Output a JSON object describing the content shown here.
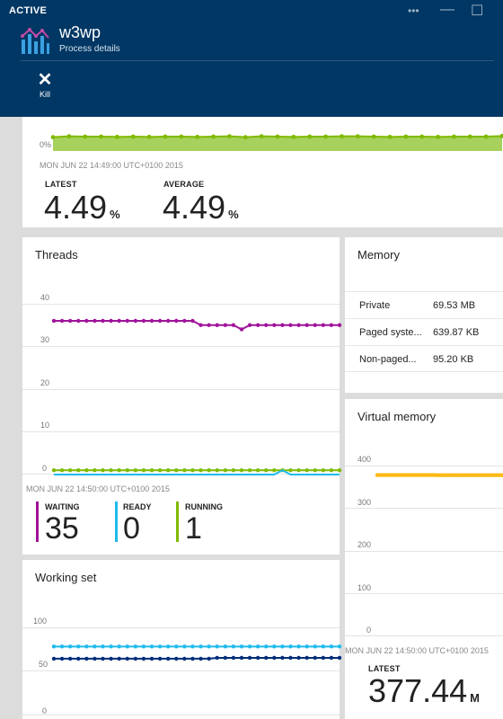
{
  "header": {
    "status": "ACTIVE",
    "ellipsis": "•••",
    "minimize": "—",
    "maximize": "☐",
    "app_name": "w3wp",
    "subtitle": "Process details",
    "kill_label": "Kill"
  },
  "cpu": {
    "axis_zero": "0%",
    "time_label": "MON JUN 22 14:49:00 UTC+0100 2015",
    "latest_label": "LATEST",
    "latest_value": "4.49",
    "average_label": "AVERAGE",
    "average_value": "4.49",
    "unit": "%"
  },
  "threads": {
    "title": "Threads",
    "y_ticks": [
      "40",
      "30",
      "20",
      "10",
      "0"
    ],
    "time_label": "MON JUN 22 14:50:00 UTC+0100 2015",
    "waiting_label": "WAITING",
    "waiting_value": "35",
    "ready_label": "READY",
    "ready_value": "0",
    "running_label": "RUNNING",
    "running_value": "1",
    "colors": {
      "waiting": "#a1129b",
      "ready": "#1ebbee",
      "running": "#7fba00"
    }
  },
  "memory": {
    "title": "Memory",
    "rows": [
      {
        "label": "Private",
        "value": "69.53 MB"
      },
      {
        "label": "Paged syste...",
        "value": "639.87 KB"
      },
      {
        "label": "Non-paged...",
        "value": "95.20 KB"
      }
    ]
  },
  "virtual_memory": {
    "title": "Virtual memory",
    "y_ticks": [
      "400",
      "300",
      "200",
      "100",
      "0"
    ],
    "time_label": "MON JUN 22 14:50:00 UTC+0100 2015",
    "latest_label": "LATEST",
    "latest_value": "377.44",
    "unit": "M",
    "color": "#fdb813"
  },
  "working_set": {
    "title": "Working set",
    "y_ticks": [
      "100",
      "50",
      "0"
    ],
    "colors": {
      "line1": "#1ebbee",
      "line2": "#002c7a"
    }
  },
  "chart_data": [
    {
      "type": "area",
      "title": "",
      "series": [
        {
          "values": [
            4.6,
            4.9,
            4.8,
            4.8,
            4.7,
            4.8,
            4.7,
            4.8,
            4.8,
            4.7,
            4.8,
            4.9,
            4.6,
            4.9,
            4.8,
            4.7,
            4.8,
            4.8,
            4.9,
            4.9,
            4.8,
            4.7,
            4.8,
            4.8,
            4.7,
            4.8,
            4.8,
            4.8,
            5.0
          ]
        }
      ],
      "ylim": [
        0,
        20
      ]
    },
    {
      "type": "line",
      "title": "Threads",
      "series": [
        {
          "name": "WAITING",
          "values": [
            36,
            36,
            36,
            36,
            36,
            36,
            36,
            36,
            36,
            36,
            36,
            36,
            36,
            36,
            36,
            36,
            36,
            36,
            35,
            35,
            35,
            35,
            35,
            34,
            35,
            35,
            35,
            35,
            35,
            35,
            35,
            35,
            35,
            35,
            35,
            35
          ]
        },
        {
          "name": "READY",
          "values": [
            0,
            0,
            0,
            0,
            0,
            0,
            0,
            0,
            0,
            0,
            0,
            0,
            0,
            0,
            0,
            0,
            0,
            0,
            0,
            0,
            0,
            0,
            0,
            0,
            0,
            0,
            0,
            0,
            1,
            0,
            0,
            0,
            0,
            0,
            0,
            0
          ]
        },
        {
          "name": "RUNNING",
          "values": [
            1,
            1,
            1,
            1,
            1,
            1,
            1,
            1,
            1,
            1,
            1,
            1,
            1,
            1,
            1,
            1,
            1,
            1,
            1,
            1,
            1,
            1,
            1,
            1,
            1,
            1,
            1,
            1,
            1,
            1,
            1,
            1,
            1,
            1,
            1,
            1
          ]
        }
      ],
      "ylim": [
        0,
        40
      ]
    },
    {
      "type": "line",
      "title": "Virtual memory",
      "series": [
        {
          "values": [
            377.7,
            377.7,
            377.7,
            377.7,
            377.7,
            377.7,
            377.7,
            377.7,
            377.7,
            377.7,
            377.7,
            377.7,
            377.7,
            377.7,
            377.7,
            377.7,
            377.7,
            377.7,
            377.7,
            377.7,
            377.7,
            377.7,
            377.7,
            377.7,
            377.7,
            377.7,
            377.7,
            377.7,
            377.5,
            377.5,
            377.5,
            377.5,
            377.44,
            377.44,
            377.44,
            377.44,
            377.44,
            377.44,
            377.44,
            377.44,
            377.44,
            377.44,
            377.44,
            377.44,
            377.44,
            377.44,
            377.44,
            377.44,
            377.44,
            377.44,
            377.44,
            377.44,
            377.44,
            377.44,
            377.44,
            377.44,
            377.44,
            377.44,
            377.44,
            377.44
          ]
        }
      ],
      "ylim": [
        0,
        400
      ]
    },
    {
      "type": "line",
      "title": "Working set",
      "series": [
        {
          "values": [
            78,
            78,
            78,
            78,
            78,
            78,
            78,
            78,
            78,
            78,
            78,
            78,
            78,
            78,
            78,
            78,
            78,
            78,
            78,
            78,
            78,
            78,
            78,
            78,
            78,
            78,
            78,
            78,
            78,
            78,
            78,
            78,
            78,
            78,
            78,
            78
          ]
        },
        {
          "values": [
            64,
            64,
            64,
            64,
            64,
            64,
            64,
            64,
            64,
            64,
            64,
            64,
            64,
            64,
            64,
            64,
            64,
            64,
            64,
            64,
            65,
            65,
            65,
            65,
            65,
            65,
            65,
            65,
            65,
            65,
            65,
            65,
            65,
            65,
            65,
            65
          ]
        }
      ],
      "ylim": [
        0,
        100
      ]
    }
  ]
}
